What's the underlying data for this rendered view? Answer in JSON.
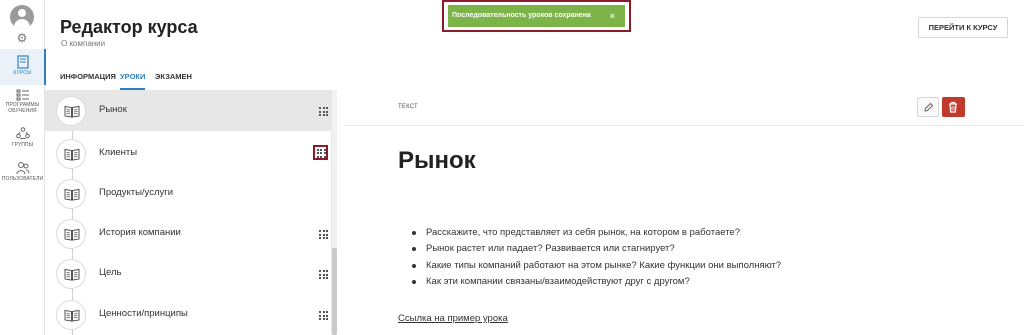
{
  "sidebar": {
    "items": [
      {
        "label": "Курсы",
        "icon": "book-icon",
        "active": true
      },
      {
        "label": "Программы обучения",
        "icon": "programs-icon",
        "active": false
      },
      {
        "label": "Группы",
        "icon": "groups-icon",
        "active": false
      },
      {
        "label": "Пользователи",
        "icon": "users-icon",
        "active": false
      }
    ]
  },
  "header": {
    "title": "Редактор курса",
    "subtitle": "О компании",
    "go_to_course": "ПЕРЕЙТИ К КУРСУ"
  },
  "tabs": [
    {
      "label": "ИНФОРМАЦИЯ",
      "active": false
    },
    {
      "label": "УРОКИ",
      "active": true
    },
    {
      "label": "ЭКЗАМЕН",
      "active": false
    }
  ],
  "toast": {
    "message": "Последовательность уроков сохранена",
    "close": "×",
    "color": "#7cb44a"
  },
  "lessons": [
    {
      "name": "Рынок",
      "active": true
    },
    {
      "name": "Клиенты",
      "active": false
    },
    {
      "name": "Продукты/услуги",
      "active": false
    },
    {
      "name": "История компании",
      "active": false
    },
    {
      "name": "Цель",
      "active": false
    },
    {
      "name": "Ценности/принципы",
      "active": false
    }
  ],
  "content": {
    "type_label": "ТЕКСТ",
    "title": "Рынок",
    "bullets": [
      "Расскажите, что представляет из себя рынок, на котором в работаете?",
      "Рынок растет или падает? Развивается или стагнирует?",
      "Какие типы компаний работают на этом рынке? Какие функции они выполняют?",
      "Как эти компании связаны/взаимодействуют друг с другом?"
    ],
    "link": "Ссылка на пример урока"
  },
  "colors": {
    "accent": "#2f7fc1",
    "danger": "#c0392b",
    "highlight": "#8b1a2b"
  }
}
